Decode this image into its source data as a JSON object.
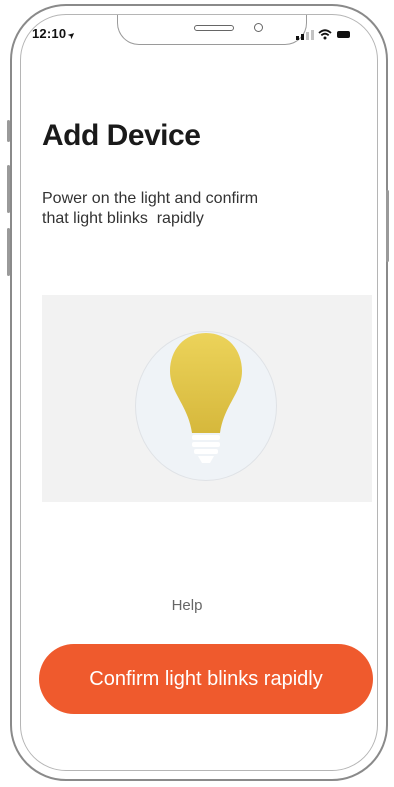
{
  "status_bar": {
    "time": "12:10",
    "location_icon": "location-arrow-icon",
    "signal_icon": "cellular-signal-icon",
    "wifi_icon": "wifi-icon",
    "battery_icon": "battery-icon"
  },
  "header": {
    "title": "Add Device"
  },
  "instruction": {
    "line1": "Power on the light and confirm",
    "line2": "that light blinks  rapidly"
  },
  "illustration": {
    "icon": "light-bulb-icon",
    "bulb_color": "#e3c444",
    "disc_color": "#eff3f7",
    "panel_color": "#f2f2f2"
  },
  "help": {
    "label": "Help"
  },
  "confirm": {
    "label": "Confirm light blinks rapidly",
    "color": "#ef5a2d"
  }
}
